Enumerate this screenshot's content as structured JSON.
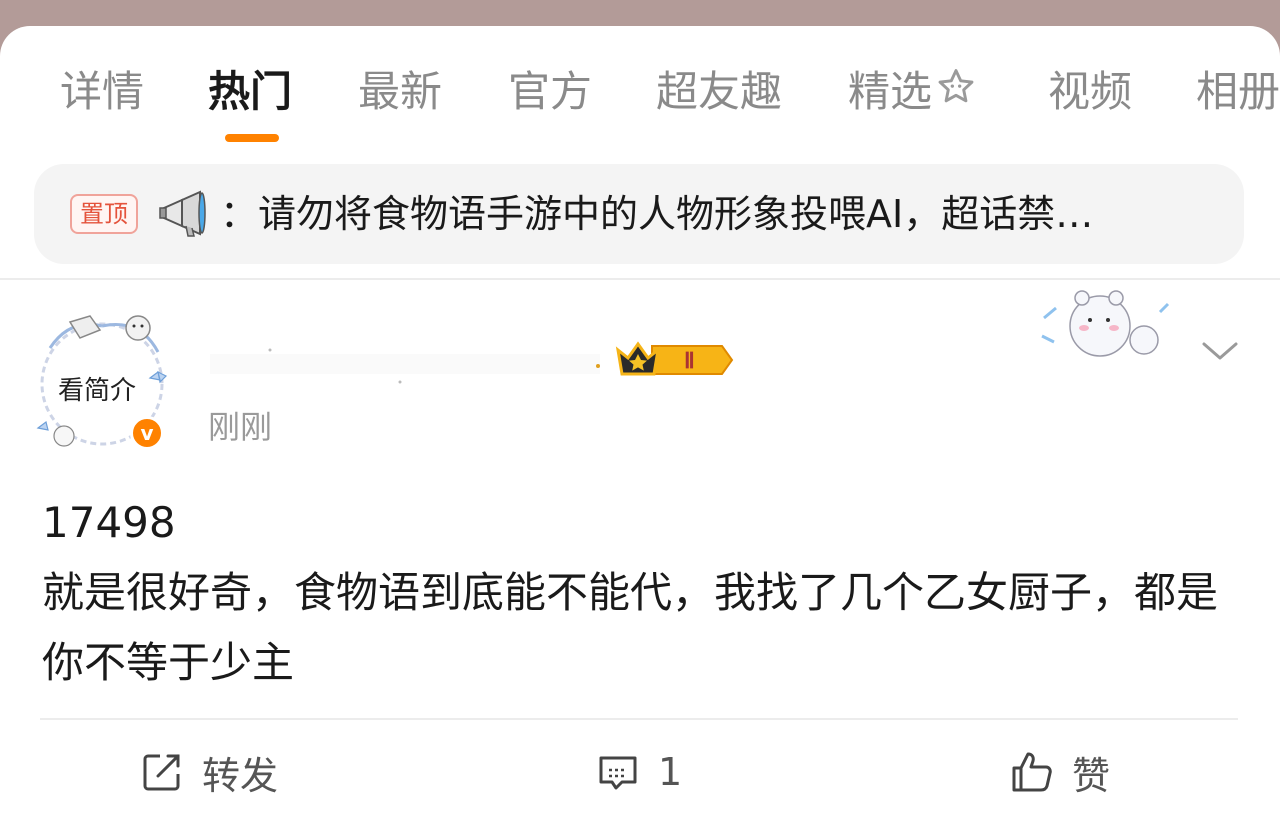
{
  "tabs": [
    {
      "label": "详情"
    },
    {
      "label": "热门"
    },
    {
      "label": "最新"
    },
    {
      "label": "官方"
    },
    {
      "label": "超友趣"
    },
    {
      "label": "精选"
    },
    {
      "label": "视频"
    },
    {
      "label": "相册"
    }
  ],
  "active_tab": "热门",
  "accent_color": "#ff8200",
  "pinned": {
    "badge": "置顶",
    "icon": "megaphone-icon",
    "text": "：请勿将食物语手游中的人物形象投喂AI，超话禁…"
  },
  "post": {
    "avatar_text": "看简介",
    "verified_icon": "verified-v-icon",
    "vip_badge": "Ⅱ",
    "time": "刚刚",
    "body_line1": "17498",
    "body_line2": "就是很好奇，食物语到底能不能代，我找了几个乙女厨子，都是你不等于少主"
  },
  "actions": {
    "repost": "转发",
    "comment": "1",
    "like": "赞"
  }
}
